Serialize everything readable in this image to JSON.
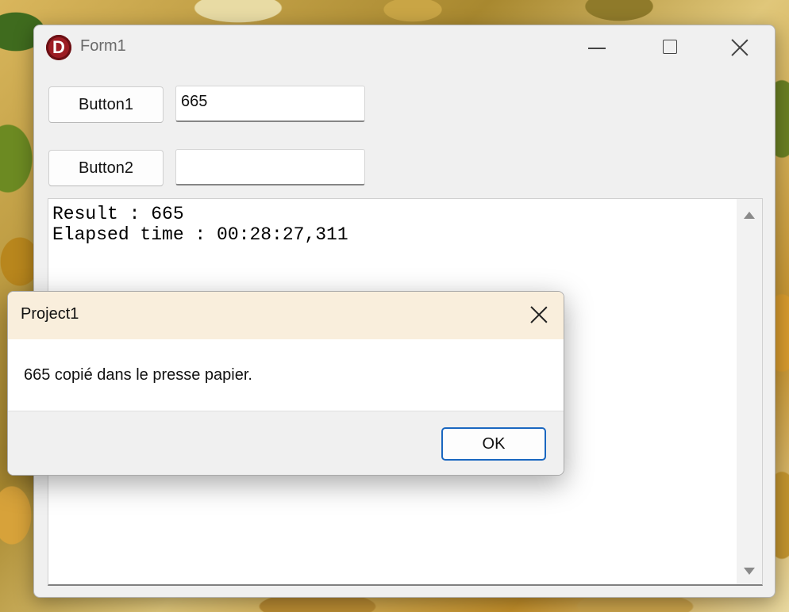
{
  "form": {
    "title": "Form1",
    "icon": "delphi-logo-icon",
    "icon_letter": "D",
    "controls": {
      "minimize": "minimize-icon",
      "maximize": "maximize-icon",
      "close": "close-icon"
    }
  },
  "buttons": {
    "button1_label": "Button1",
    "button2_label": "Button2"
  },
  "edits": {
    "edit1_value": "665",
    "edit2_value": ""
  },
  "memo": {
    "lines": [
      "Result : 665",
      "Elapsed time : 00:28:27,311"
    ]
  },
  "dialog": {
    "title": "Project1",
    "message": "665 copié dans le presse papier.",
    "ok_label": "OK",
    "title_bar_color": "#f9eedc",
    "accent_color": "#1a67c0"
  }
}
